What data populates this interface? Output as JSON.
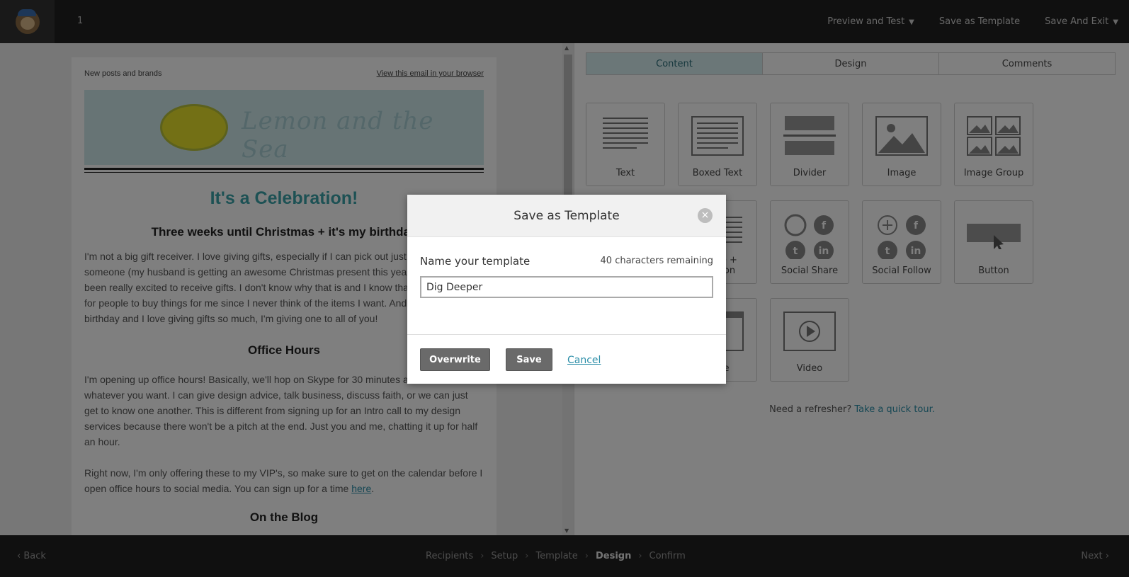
{
  "topbar": {
    "campaign_number": "1",
    "actions": [
      "Preview and Test",
      "Save as Template",
      "Save And Exit"
    ]
  },
  "email": {
    "preheader": "New posts and brands",
    "view_in_browser": "View this email in your browser",
    "brand_name": "Lemon and the Sea",
    "heading": "It's a Celebration!",
    "subheading": "Three weeks until Christmas + it's my birthday",
    "paragraph1": "I'm not a big gift receiver. I love giving gifts, especially if I can pick out just the right thing for someone (my husband is getting an awesome Christmas present this year), but I've never been really excited to receive gifts. I don't know why that is and I know that it makes it hard for people to buy things for me since I never think of the items I want. And since it's my birthday and I love giving gifts so much, I'm giving one to all of you!",
    "section_office_hours": "Office Hours",
    "paragraph2": "I'm opening up office hours! Basically, we'll hop on Skype for 30 minutes and chat about whatever you want. I can give design advice, talk business, discuss faith, or we can just get to know one another. This is different from signing up for an Intro call to my design services because there won't be a pitch at the end. Just you and me, chatting it up for half an hour.",
    "paragraph3_text": "Right now, I'm only offering these to my VIP's, so make sure to get on the calendar before I open office hours to social media. You can sign up for a time ",
    "paragraph3_link": "here",
    "paragraph3_end": ".",
    "section_blog": "On the Blog"
  },
  "panel": {
    "tabs": [
      {
        "label": "Content",
        "active": true
      },
      {
        "label": "Design",
        "active": false
      },
      {
        "label": "Comments",
        "active": false
      }
    ],
    "blocks": {
      "text": "Text",
      "boxed_text": "Boxed Text",
      "divider": "Divider",
      "image": "Image",
      "image_group": "Image Group",
      "image_caption": "Image + Caption",
      "social_share": "Social Share",
      "social_follow": "Social Follow",
      "button": "Button",
      "code": "Code",
      "video": "Video"
    },
    "refresher_text": "Need a refresher?",
    "refresher_link": "Take a quick tour."
  },
  "footer": {
    "back": "Back",
    "next": "Next",
    "steps": [
      "Recipients",
      "Setup",
      "Template",
      "Design",
      "Confirm"
    ],
    "current_step": "Design"
  },
  "modal": {
    "title": "Save as Template",
    "name_label": "Name your template",
    "chars_remaining": "40 characters remaining",
    "input_value": "Dig Deeper",
    "overwrite_label": "Overwrite",
    "save_label": "Save",
    "cancel_label": "Cancel"
  },
  "colors": {
    "accent": "#2b8ea8",
    "heading_teal": "#3aa3a9",
    "active_tab": "#d6eef1",
    "topbar": "#202020",
    "button_gray": "#6a6a6a"
  }
}
